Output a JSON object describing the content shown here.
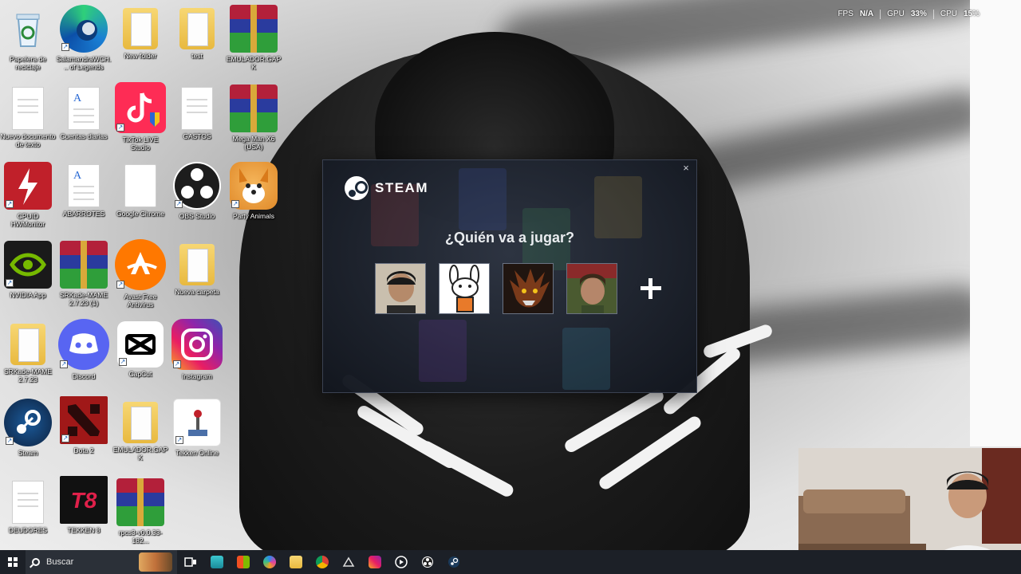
{
  "desktop": {
    "icons": [
      {
        "label": "Papelera de reciclaje",
        "icon": "recycle-bin-icon"
      },
      {
        "label": "SalamandraWCH... of Legends",
        "icon": "edge-icon"
      },
      {
        "label": "New folder",
        "icon": "folder-icon"
      },
      {
        "label": "test",
        "icon": "folder-icon"
      },
      {
        "label": "EMULADOR.GAPK",
        "icon": "winrar-icon"
      },
      {
        "label": "Nuevo documento de texto",
        "icon": "text-document-icon"
      },
      {
        "label": "Cuentas diarias",
        "icon": "wordpad-document-icon"
      },
      {
        "label": "TikTok LIVE Studio",
        "icon": "tiktok-icon"
      },
      {
        "label": "GASTOS",
        "icon": "text-document-icon"
      },
      {
        "label": "Mega Man X6 (USA)",
        "icon": "winrar-icon"
      },
      {
        "label": "CPUID HWMonitor",
        "icon": "hwmonitor-icon"
      },
      {
        "label": "ABARROTES",
        "icon": "wordpad-document-icon"
      },
      {
        "label": "Google Chrome",
        "icon": "blank-file-icon"
      },
      {
        "label": "OBS Studio",
        "icon": "obs-icon"
      },
      {
        "label": "Party Animals",
        "icon": "party-animals-icon"
      },
      {
        "label": "NVIDIA App",
        "icon": "nvidia-icon"
      },
      {
        "label": "SRKade-MAME 2.7.23 (1)",
        "icon": "winrar-icon"
      },
      {
        "label": "Avast Free Antivirus",
        "icon": "avast-icon"
      },
      {
        "label": "Nueva carpeta",
        "icon": "folder-icon"
      },
      {
        "label": "SRKade-MAME 2.7.23",
        "icon": "folder-icon"
      },
      {
        "label": "Discord",
        "icon": "discord-icon"
      },
      {
        "label": "CapCut",
        "icon": "capcut-icon"
      },
      {
        "label": "Instagram",
        "icon": "instagram-icon"
      },
      {
        "label": "Steam",
        "icon": "steam-icon"
      },
      {
        "label": "Dota 2",
        "icon": "dota2-icon"
      },
      {
        "label": "EMULADOR.GAPK",
        "icon": "folder-icon"
      },
      {
        "label": "Tekken Online",
        "icon": "joystick-icon"
      },
      {
        "label": "DEUDORES",
        "icon": "text-document-icon"
      },
      {
        "label": "TEKKEN 8",
        "icon": "tekken8-icon"
      },
      {
        "label": "rpcs3-v0.0.33-182...",
        "icon": "winrar-icon"
      }
    ]
  },
  "overlay": {
    "fps_label": "FPS",
    "fps_value": "N/A",
    "gpu_label": "GPU",
    "gpu_value": "33",
    "gpu_unit": "%",
    "cpu_label": "CPU",
    "cpu_value": "15",
    "cpu_unit": "%"
  },
  "steam": {
    "brand": "STEAM",
    "close_glyph": "×",
    "title": "¿Quién va a jugar?",
    "profiles": [
      {
        "avatar": "boy-photo-avatar"
      },
      {
        "avatar": "cartoon-rabbit-avatar"
      },
      {
        "avatar": "werewolf-avatar"
      },
      {
        "avatar": "man-photo-avatar"
      }
    ],
    "add_icon": "plus-icon"
  },
  "taskbar": {
    "search_placeholder": "Buscar",
    "apps": [
      "task-view-icon",
      "app-icon",
      "store-icon",
      "copilot-icon",
      "file-explorer-icon",
      "chrome-icon",
      "nvidia-icon",
      "instagram-icon",
      "media-player-icon",
      "obs-icon",
      "steam-icon"
    ]
  },
  "colors": {
    "steam_dialog_bg": "#1b2330",
    "taskbar_bg": "#1c2027"
  }
}
